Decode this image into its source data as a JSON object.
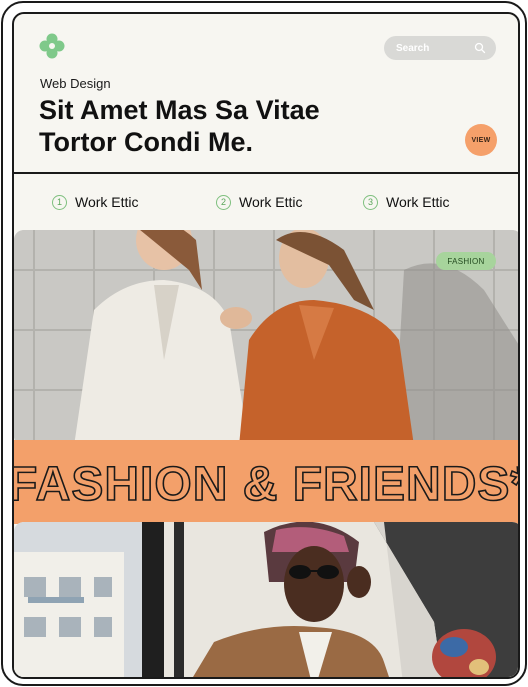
{
  "header": {
    "search_label": "Search",
    "kicker": "Web Design",
    "headline": "Sit Amet Mas Sa Vitae Tortor Condi Me.",
    "view_label": "VIEW"
  },
  "steps": [
    {
      "num": "1",
      "label": "Work Ettic"
    },
    {
      "num": "2",
      "label": "Work Ettic"
    },
    {
      "num": "3",
      "label": "Work Ettic"
    }
  ],
  "hero": {
    "tag": "FASHION"
  },
  "banner": {
    "text": "FASHION & FRIENDS*"
  },
  "colors": {
    "accent_orange": "#f3a06a",
    "accent_green": "#a7d49c",
    "logo_green": "#7fc98a",
    "background": "#f7f6f1"
  }
}
